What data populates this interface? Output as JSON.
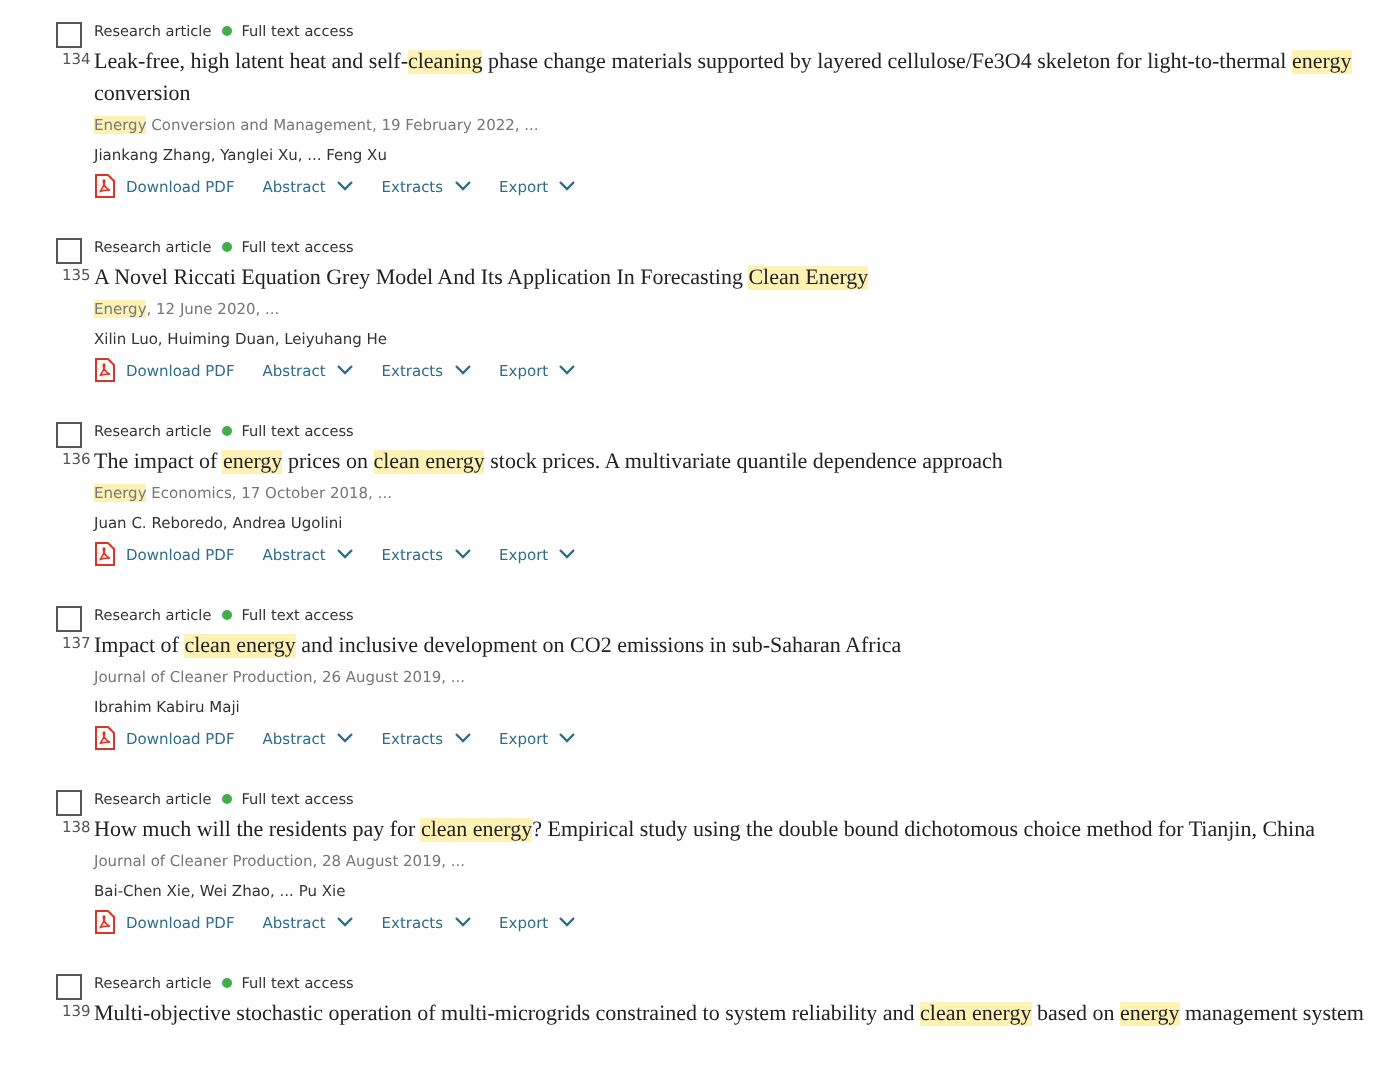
{
  "results": [
    {
      "number": "134",
      "checked": false,
      "type": "Research article",
      "access": "Full text access",
      "title": [
        {
          "text": "Leak-free, high latent heat and self-",
          "highlight": false
        },
        {
          "text": "cleaning",
          "highlight": true
        },
        {
          "text": " phase change materials supported by layered cellulose/Fe3O4 skeleton for light-to-thermal ",
          "highlight": false
        },
        {
          "text": "energy",
          "highlight": true
        },
        {
          "text": " conversion",
          "highlight": false
        }
      ],
      "source": [
        {
          "text": "Energy",
          "highlight": true
        },
        {
          "text": " Conversion and Management, 19 February 2022, ...",
          "highlight": false
        }
      ],
      "authors": "Jiankang Zhang, Yanglei Xu, ... Feng Xu",
      "actions": [
        {
          "kind": "pdf",
          "label": "Download PDF"
        },
        {
          "kind": "menu",
          "label": "Abstract"
        },
        {
          "kind": "menu",
          "label": "Extracts"
        },
        {
          "kind": "menu",
          "label": "Export"
        }
      ]
    },
    {
      "number": "135",
      "checked": false,
      "type": "Research article",
      "access": "Full text access",
      "title": [
        {
          "text": "A Novel Riccati Equation Grey Model And Its Application In Forecasting ",
          "highlight": false
        },
        {
          "text": "Clean Energy",
          "highlight": true
        }
      ],
      "source": [
        {
          "text": "Energy",
          "highlight": true
        },
        {
          "text": ", 12 June 2020, ...",
          "highlight": false
        }
      ],
      "authors": "Xilin Luo, Huiming Duan, Leiyuhang He",
      "actions": [
        {
          "kind": "pdf",
          "label": "Download PDF"
        },
        {
          "kind": "menu",
          "label": "Abstract"
        },
        {
          "kind": "menu",
          "label": "Extracts"
        },
        {
          "kind": "menu",
          "label": "Export"
        }
      ]
    },
    {
      "number": "136",
      "checked": false,
      "type": "Research article",
      "access": "Full text access",
      "title": [
        {
          "text": "The impact of ",
          "highlight": false
        },
        {
          "text": "energy",
          "highlight": true
        },
        {
          "text": " prices on ",
          "highlight": false
        },
        {
          "text": "clean energy",
          "highlight": true
        },
        {
          "text": " stock prices. A multivariate quantile dependence approach",
          "highlight": false
        }
      ],
      "source": [
        {
          "text": "Energy",
          "highlight": true
        },
        {
          "text": " Economics, 17 October 2018, ...",
          "highlight": false
        }
      ],
      "authors": "Juan C. Reboredo, Andrea Ugolini",
      "actions": [
        {
          "kind": "pdf",
          "label": "Download PDF"
        },
        {
          "kind": "menu",
          "label": "Abstract"
        },
        {
          "kind": "menu",
          "label": "Extracts"
        },
        {
          "kind": "menu",
          "label": "Export"
        }
      ]
    },
    {
      "number": "137",
      "checked": false,
      "type": "Research article",
      "access": "Full text access",
      "title": [
        {
          "text": "Impact of ",
          "highlight": false
        },
        {
          "text": "clean energy",
          "highlight": true
        },
        {
          "text": " and inclusive development on CO2 emissions in sub-Saharan Africa",
          "highlight": false
        }
      ],
      "source": [
        {
          "text": "Journal of Cleaner Production, 26 August 2019, ...",
          "highlight": false
        }
      ],
      "authors": "Ibrahim Kabiru Maji",
      "actions": [
        {
          "kind": "pdf",
          "label": "Download PDF"
        },
        {
          "kind": "menu",
          "label": "Abstract"
        },
        {
          "kind": "menu",
          "label": "Extracts"
        },
        {
          "kind": "menu",
          "label": "Export"
        }
      ]
    },
    {
      "number": "138",
      "checked": false,
      "type": "Research article",
      "access": "Full text access",
      "title": [
        {
          "text": "How much will the residents pay for ",
          "highlight": false
        },
        {
          "text": "clean energy",
          "highlight": true
        },
        {
          "text": "? Empirical study using the double bound dichotomous choice method for Tianjin, China",
          "highlight": false
        }
      ],
      "source": [
        {
          "text": "Journal of Cleaner Production, 28 August 2019, ...",
          "highlight": false
        }
      ],
      "authors": "Bai-Chen Xie, Wei Zhao, ... Pu Xie",
      "actions": [
        {
          "kind": "pdf",
          "label": "Download PDF"
        },
        {
          "kind": "menu",
          "label": "Abstract"
        },
        {
          "kind": "menu",
          "label": "Extracts"
        },
        {
          "kind": "menu",
          "label": "Export"
        }
      ]
    },
    {
      "number": "139",
      "checked": false,
      "type": "Research article",
      "access": "Full text access",
      "title": [
        {
          "text": "Multi-objective stochastic operation of multi-microgrids constrained to system reliability and ",
          "highlight": false
        },
        {
          "text": "clean energy",
          "highlight": true
        },
        {
          "text": " based on ",
          "highlight": false
        },
        {
          "text": "energy",
          "highlight": true
        },
        {
          "text": " management system",
          "highlight": false
        }
      ]
    }
  ]
}
